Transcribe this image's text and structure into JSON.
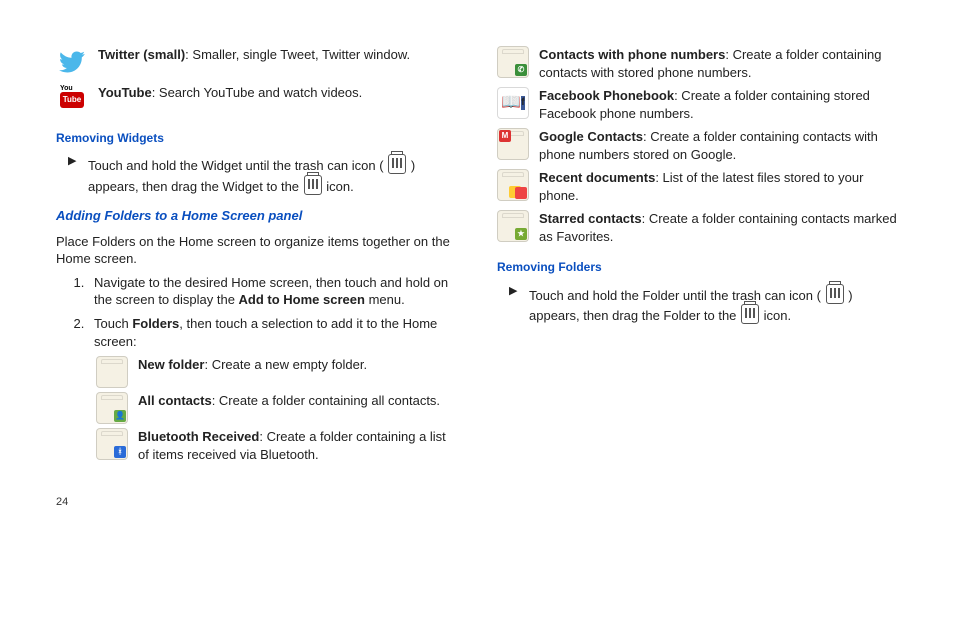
{
  "left": {
    "twitter": {
      "name": "Twitter (small)",
      "desc": ": Smaller, single Tweet, Twitter window."
    },
    "youtube": {
      "name": "YouTube",
      "desc": ": Search YouTube and watch videos."
    },
    "removingWidgets": {
      "heading": "Removing Widgets",
      "line1": "Touch and hold the Widget until the trash can icon (",
      "line2": ") appears, then drag the Widget to the ",
      "line3": " icon."
    },
    "addingFolders": {
      "heading": "Adding Folders to a Home Screen panel",
      "intro": "Place Folders on the Home screen to organize items together on the Home screen."
    },
    "steps": {
      "s1a": "Navigate to the desired Home screen, then touch and hold on the screen to display the ",
      "s1b": "Add to Home screen",
      "s1c": " menu.",
      "s2a": "Touch ",
      "s2b": "Folders",
      "s2c": ", then touch a selection to add it to the Home screen:"
    },
    "folders": {
      "newFolder": {
        "name": "New folder",
        "desc": ": Create a new empty folder."
      },
      "allContacts": {
        "name": "All contacts",
        "desc": ": Create a folder containing all contacts."
      },
      "btReceived": {
        "name": "Bluetooth Received",
        "desc": ": Create a folder containing a list of items received via Bluetooth."
      }
    }
  },
  "right": {
    "folders": {
      "phoneNums": {
        "name": "Contacts with phone numbers",
        "desc": ": Create a folder containing contacts with stored phone numbers."
      },
      "fb": {
        "name": "Facebook Phonebook",
        "desc": ": Create a folder containing stored Facebook phone numbers."
      },
      "google": {
        "name": "Google Contacts",
        "desc": ": Create a folder containing contacts with phone numbers stored on Google."
      },
      "recent": {
        "name": "Recent documents",
        "desc": ": List of the latest files stored to your phone."
      },
      "starred": {
        "name": "Starred contacts",
        "desc": ": Create a folder containing contacts marked as Favorites."
      }
    },
    "removingFolders": {
      "heading": "Removing Folders",
      "line1": "Touch and hold the Folder until the trash can icon (",
      "line2": ") appears, then drag the Folder to the ",
      "line3": " icon."
    }
  },
  "pageNumber": "24"
}
